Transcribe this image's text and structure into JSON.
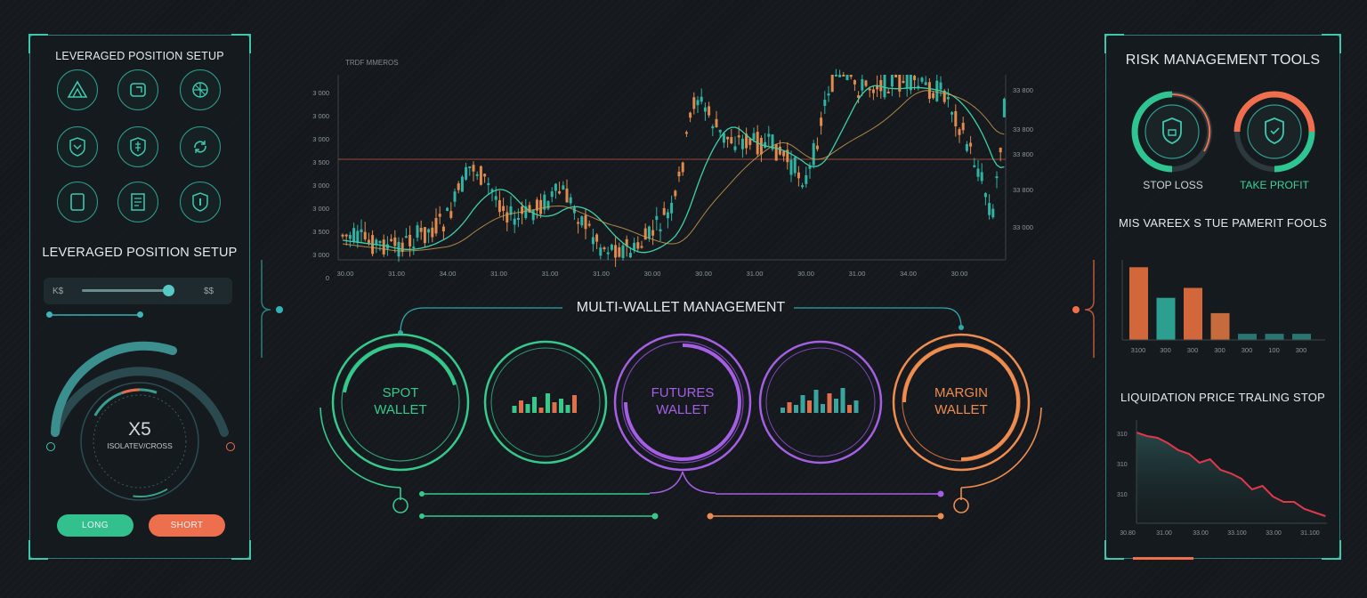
{
  "left_panel": {
    "title_top": "LEVERAGED POSITION SETUP",
    "title_mid": "LEVERAGED POSITION SETUP",
    "slider_left": "K$",
    "slider_right": "$$",
    "icons": [
      "mountain-icon",
      "wallet-icon",
      "network-icon",
      "shield-chevron-icon",
      "shield-dollar-icon",
      "refresh-icon",
      "tablet-icon",
      "receipt-icon",
      "shield-icon"
    ],
    "leverage_value": "X5",
    "margin_mode": "ISOLATEV/CROSS",
    "long_label": "LONG",
    "short_label": "SHORT",
    "colors": {
      "accent": "#2fc59a",
      "long": "#33c38f",
      "short": "#ef6e4c"
    }
  },
  "chart": {
    "caption": "TRDF MMEROS",
    "y_ticks_left": [
      "3 000",
      "3 000",
      "3 000",
      "3 500",
      "3 000",
      "3 000",
      "3 500",
      "3 000",
      "0"
    ],
    "y_ticks_right": [
      "33 800",
      "33 800",
      "33 800",
      "33 800",
      "33 000"
    ],
    "x_ticks": [
      "30.00",
      "31.00",
      "34.00",
      "31.00",
      "31.00",
      "31.00",
      "30.00",
      "30.00",
      "31.00",
      "30.00",
      "31.00",
      "34.00",
      "30.00"
    ]
  },
  "wallets": {
    "title": "MULTI-WALLET MANAGEMENT",
    "spot": {
      "line1": "SPOT",
      "line2": "WALLET",
      "color": "#35c98b"
    },
    "futures": {
      "line1": "FUTURES",
      "line2": "WALLET",
      "color": "#a45fe2"
    },
    "margin": {
      "line1": "MARGIN",
      "line2": "WALLET",
      "color": "#ef8c4f"
    }
  },
  "right_panel": {
    "title": "RISK MANAGEMENT TOOLS",
    "stop_loss": "STOP LOSS",
    "take_profit": "TAKE PROFIT",
    "subtitle": "MIS VAREEX S TUE PAMERIT FOOLS",
    "bar_x_ticks": [
      "3100",
      "300",
      "300",
      "300",
      "300",
      "100",
      "300"
    ],
    "bar_values": [
      0.95,
      0.55,
      0.68,
      0.35,
      0.08,
      0.08,
      0.08
    ],
    "bar_colors": [
      "#e6703e",
      "#2fae9c",
      "#e6703e",
      "#d9763f",
      "#2c7f7a",
      "#2c7f7a",
      "#2c7f7a"
    ],
    "liq_title": "LIQUIDATION PRICE TRALING STOP",
    "liq_y_ticks": [
      "310",
      "310",
      "310"
    ],
    "liq_x_ticks": [
      "30.80",
      "31.00",
      "33.00",
      "33.100",
      "33.00",
      "31.100"
    ]
  }
}
